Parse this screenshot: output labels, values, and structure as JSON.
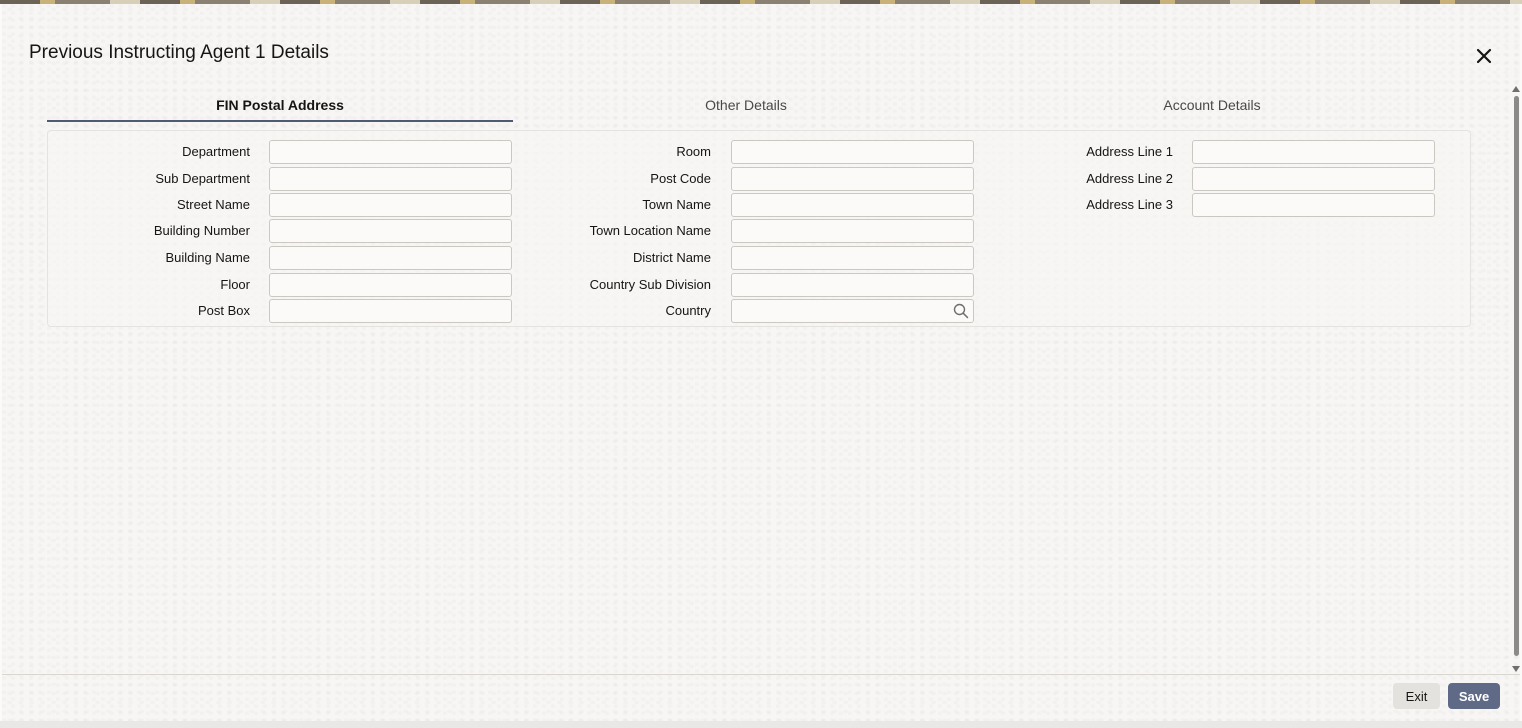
{
  "dialog": {
    "title": "Previous Instructing Agent 1 Details"
  },
  "tabs": [
    {
      "label": "FIN Postal Address",
      "active": true
    },
    {
      "label": "Other Details",
      "active": false
    },
    {
      "label": "Account Details",
      "active": false
    }
  ],
  "form": {
    "column1": [
      {
        "label": "Department",
        "value": ""
      },
      {
        "label": "Sub Department",
        "value": ""
      },
      {
        "label": "Street Name",
        "value": ""
      },
      {
        "label": "Building Number",
        "value": ""
      },
      {
        "label": "Building Name",
        "value": ""
      },
      {
        "label": "Floor",
        "value": ""
      },
      {
        "label": "Post Box",
        "value": ""
      }
    ],
    "column2": [
      {
        "label": "Room",
        "value": ""
      },
      {
        "label": "Post Code",
        "value": ""
      },
      {
        "label": "Town Name",
        "value": ""
      },
      {
        "label": "Town Location Name",
        "value": ""
      },
      {
        "label": "District Name",
        "value": ""
      },
      {
        "label": "Country Sub Division",
        "value": ""
      },
      {
        "label": "Country",
        "value": "",
        "icon": "search-icon"
      }
    ],
    "column3": [
      {
        "label": "Address Line 1",
        "value": ""
      },
      {
        "label": "Address Line 2",
        "value": ""
      },
      {
        "label": "Address Line 3",
        "value": ""
      }
    ]
  },
  "footer": {
    "exit_label": "Exit",
    "save_label": "Save"
  },
  "colors": {
    "accent": "#5e6a86",
    "tab_underline": "#4f5a73"
  }
}
